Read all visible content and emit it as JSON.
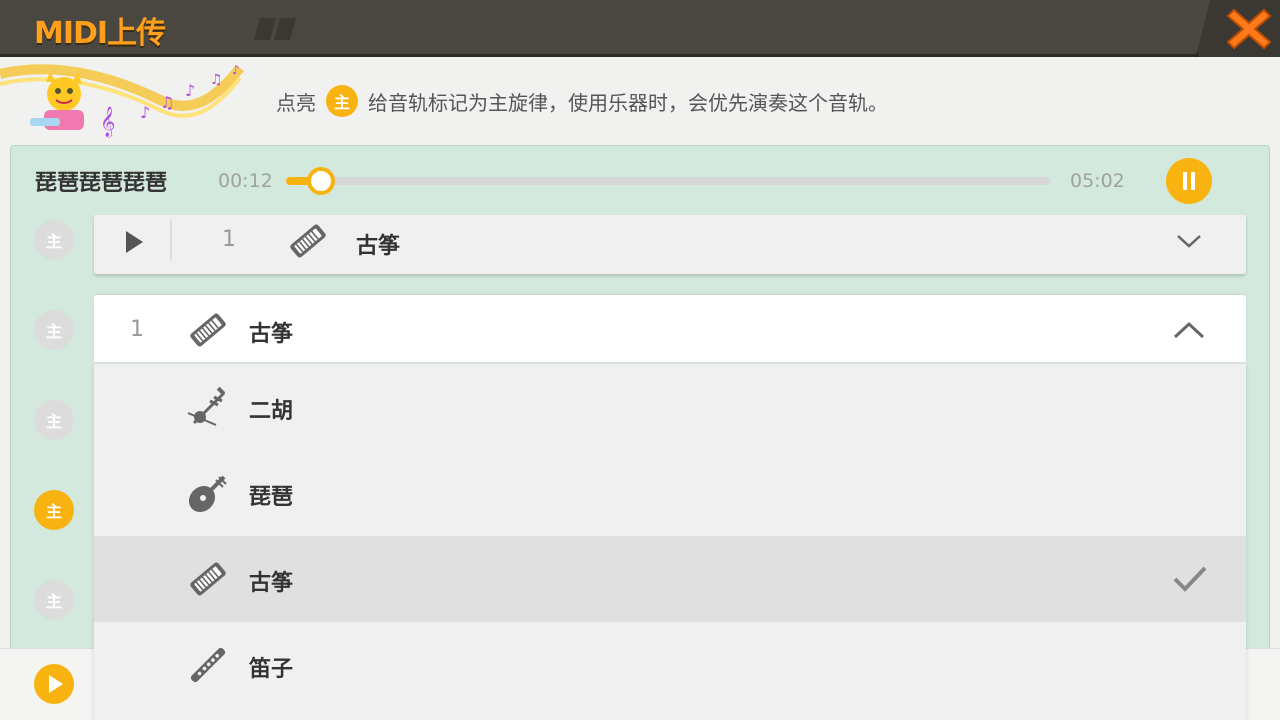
{
  "app": {
    "title": "MIDI上传"
  },
  "tip": {
    "prefix": "点亮",
    "badge": "主",
    "suffix": "给音轨标记为主旋律，使用乐器时，会优先演奏这个音轨。"
  },
  "player": {
    "file_name": "琵琶琵琶琵琶",
    "current_time": "00:12",
    "total_time": "05:02",
    "progress": 0.046
  },
  "side_badges": [
    {
      "label": "主",
      "active": false
    },
    {
      "label": "主",
      "active": false
    },
    {
      "label": "主",
      "active": false
    },
    {
      "label": "主",
      "active": true
    },
    {
      "label": "主",
      "active": false
    }
  ],
  "track": {
    "number": "1",
    "instrument": "古筝",
    "icon": "guzheng-icon"
  },
  "dropdown": {
    "number": "1",
    "selected_instrument": "古筝",
    "selected_icon": "guzheng-icon",
    "options": [
      {
        "label": "二胡",
        "icon": "erhu-icon",
        "selected": false
      },
      {
        "label": "琵琶",
        "icon": "pipa-icon",
        "selected": false
      },
      {
        "label": "古筝",
        "icon": "guzheng-icon",
        "selected": true
      },
      {
        "label": "笛子",
        "icon": "dizi-icon",
        "selected": false
      }
    ]
  },
  "colors": {
    "accent": "#f9b310",
    "title_orange": "#ff9f1c",
    "panel_green": "#d4e9dd",
    "titlebar": "#4a4741"
  }
}
